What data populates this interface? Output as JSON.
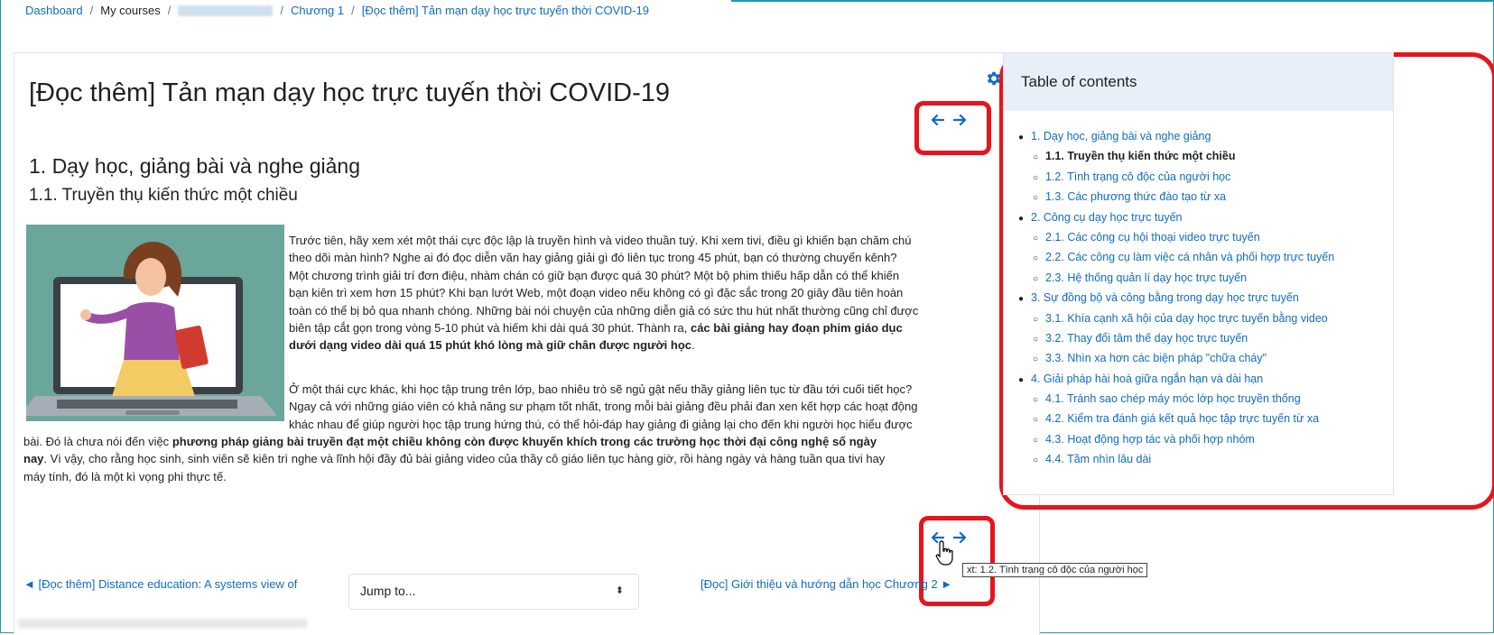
{
  "breadcrumb": {
    "dashboard": "Dashboard",
    "my_courses": "My courses",
    "chapter": "Chương 1",
    "current": "[Đọc thêm] Tản mạn dạy học trực tuyến thời COVID-19"
  },
  "page": {
    "title": "[Đọc thêm] Tản mạn dạy học trực tuyến thời COVID-19",
    "h2": "1. Dạy học, giảng bài và nghe giảng",
    "h3": "1.1. Truyền thụ kiến thức một chiều"
  },
  "content": {
    "p1_lines": [
      "Trước tiên, hãy xem xét một thái cực độc lập là truyền hình và video thuần tuý. Khi xem tivi, điều gì khiến bạn chăm chú",
      "theo dõi màn hình? Nghe ai đó đọc diễn văn hay giảng giải gì đó liên tục trong 45 phút, bạn có thường chuyển kênh?",
      "Một chương trình giải trí đơn điệu, nhàm chán có giữ bạn được quá 30 phút? Một bộ phim thiếu hấp dẫn có thể khiến",
      "bạn kiên trì xem hơn 15 phút? Khi bạn lướt Web, một đoạn video nếu không có gì đặc sắc trong 20 giây đầu tiên hoàn",
      "toàn có thể bị bỏ qua nhanh chóng. Những bài nói chuyện của những diễn giả có sức thu hút nhất thường cũng chỉ được",
      "biên tập cắt gọn trong vòng 5-10 phút và hiếm khi dài quá 30 phút. Thành ra, "
    ],
    "p1_bold_a": "các bài giảng hay đoạn phim giáo dục",
    "p1_bold_b": "dưới dạng video dài quá 15 phút khó lòng mà giữ chân được người học",
    "p1_end": ".",
    "p2_lines": [
      "Ở một thái cực khác, khi học tập trung trên lớp, bao nhiêu trò sẽ ngủ gật nếu thầy giảng liên tục từ đầu tới cuối tiết học?",
      "Ngay cả với những giáo viên có khả năng sư phạm tốt nhất, trong mỗi bài giảng đều phải đan xen kết hợp các hoạt động",
      "khác nhau để giúp người học tập trung hứng thú, có thể hỏi-đáp hay giảng đi giảng lại cho đến khi người học hiểu được"
    ],
    "p2_a": "bài. Đó là chưa nói đến việc ",
    "p2_bold_a": "phương pháp giảng bài truyền đạt một chiều không còn được khuyến khích trong các trường học thời đại công nghệ số ngày",
    "p2_bold_b": "nay",
    "p2_b": ". Vì vậy, cho rằng học sinh, sinh viên sẽ kiên trì nghe và lĩnh hội đầy đủ bài giảng video của thầy cô giáo liên tục hàng giờ, rồi hàng ngày và hàng tuần qua tivi hay",
    "p2_c": "máy tính, đó là một kì vọng phi thực tế."
  },
  "bottom_nav": {
    "prev": "◄ [Đọc thêm] Distance education: A systems view of",
    "jump_label": "Jump to...",
    "next": "[Đọc] Giới thiệu và hướng dẫn học Chương 2 ►"
  },
  "tooltip": "xt: 1.2. Tình trạng cô độc của người học",
  "toc": {
    "title": "Table of contents",
    "items": [
      {
        "label": "1. Dạy học, giảng bài và nghe giảng",
        "level": 1
      },
      {
        "label": "1.1. Truyền thụ kiến thức một chiều",
        "level": 2
      },
      {
        "label": "1.2. Tình trạng cô độc của người học",
        "level": 2
      },
      {
        "label": "1.3. Các phương thức đào tạo từ xa",
        "level": 2
      },
      {
        "label": "2. Công cụ dạy học trực tuyến",
        "level": 1
      },
      {
        "label": "2.1. Các công cụ hội thoại video trực tuyến",
        "level": 2
      },
      {
        "label": "2.2. Các công cụ làm việc cá nhân và phối hợp trực tuyến",
        "level": 2
      },
      {
        "label": "2.3. Hệ thống quản lí dạy học trực tuyến",
        "level": 2
      },
      {
        "label": "3. Sự đồng bộ và công bằng trong dạy học trực tuyến",
        "level": 1
      },
      {
        "label": "3.1. Khía cạnh xã hội của dạy học trực tuyến bằng video",
        "level": 2
      },
      {
        "label": "3.2. Thay đổi tâm thế dạy học trực tuyến",
        "level": 2
      },
      {
        "label": "3.3. Nhìn xa hơn các biện pháp \"chữa cháy\"",
        "level": 2
      },
      {
        "label": "4. Giải pháp hài hoà giữa ngắn hạn và dài hạn",
        "level": 1
      },
      {
        "label": "4.1. Tránh sao chép máy móc lớp học truyền thống",
        "level": 2
      },
      {
        "label": "4.2. Kiểm tra đánh giá kết quả học tập trực tuyến từ xa",
        "level": 2
      },
      {
        "label": "4.3. Hoạt động hợp tác và phối hợp nhóm",
        "level": 2
      },
      {
        "label": "4.4. Tầm nhìn lâu dài",
        "level": 2
      }
    ],
    "current_index": 1
  },
  "colors": {
    "link": "#0f6cbf",
    "highlight": "#e8141c",
    "toc_header_bg": "#e9eff8",
    "illustration_bg": "#6aa699"
  }
}
